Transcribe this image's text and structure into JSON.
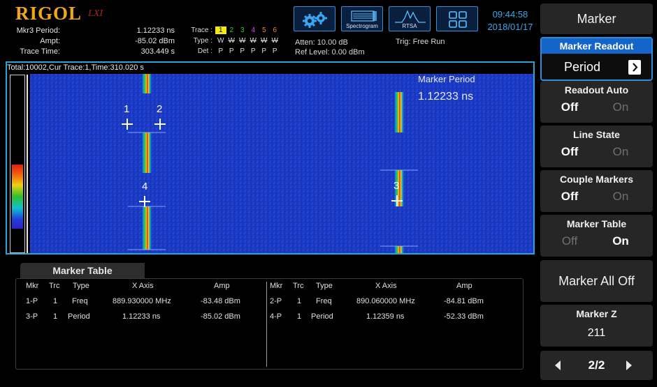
{
  "brand": {
    "logo": "RIGOL",
    "suffix": "LXI"
  },
  "marker_info": {
    "rows": [
      {
        "label": "Mkr3 Period:",
        "value": "1.12233 ns"
      },
      {
        "label": "Ampt:",
        "value": "-85.02 dBm"
      },
      {
        "label": "Trace Time:",
        "value": "303.449 s"
      }
    ]
  },
  "trace_info": {
    "trace_label": "Trace :",
    "trace_nums": [
      "1",
      "2",
      "3",
      "4",
      "5",
      "6"
    ],
    "type_label": "Type :",
    "types": [
      "W",
      "W",
      "W",
      "W",
      "W",
      "W"
    ],
    "det_label": "Det :",
    "dets": [
      "P",
      "P",
      "P",
      "P",
      "P",
      "P"
    ]
  },
  "rf_info": {
    "atten": "Atten: 10.00 dB",
    "ref_level": "Ref Level: 0.00 dBm",
    "trig": "Trig: Free Run"
  },
  "toolbar": {
    "spectrogram": "Spectrogram",
    "rtsa": "RTSA"
  },
  "clock": {
    "time": "09:44:58",
    "date": "2018/01/17"
  },
  "spectrogram": {
    "header": "Total:10002,Cur Trace:1,Time:310.020 s",
    "readout_title": "Marker Period",
    "readout_value": "1.12233 ns",
    "markers": [
      "1",
      "2",
      "4",
      "3"
    ]
  },
  "marker_table": {
    "tab_title": "Marker Table",
    "headers": [
      "Mkr",
      "Trc",
      "Type",
      "X Axis",
      "Amp"
    ],
    "left_rows": [
      {
        "mkr": "1-P",
        "trc": "1",
        "type": "Freq",
        "x": "889.930000 MHz",
        "amp": "-83.48 dBm"
      },
      {
        "mkr": "3-P",
        "trc": "1",
        "type": "Period",
        "x": "1.12233 ns",
        "amp": "-85.02 dBm"
      }
    ],
    "right_rows": [
      {
        "mkr": "2-P",
        "trc": "1",
        "type": "Freq",
        "x": "890.060000 MHz",
        "amp": "-84.81 dBm"
      },
      {
        "mkr": "4-P",
        "trc": "1",
        "type": "Period",
        "x": "1.12359 ns",
        "amp": "-52.33 dBm"
      }
    ]
  },
  "menu": {
    "title": "Marker",
    "readout": {
      "label": "Marker Readout",
      "value": "Period"
    },
    "readout_auto": {
      "label": "Readout Auto",
      "off": "Off",
      "on": "On",
      "state": "off"
    },
    "line_state": {
      "label": "Line State",
      "off": "Off",
      "on": "On",
      "state": "off"
    },
    "couple_markers": {
      "label": "Couple Markers",
      "off": "Off",
      "on": "On",
      "state": "off"
    },
    "marker_table": {
      "label": "Marker Table",
      "off": "Off",
      "on": "On",
      "state": "on"
    },
    "marker_all_off": "Marker All Off",
    "marker_z": {
      "label": "Marker Z",
      "value": "211"
    },
    "page": "2/2"
  }
}
